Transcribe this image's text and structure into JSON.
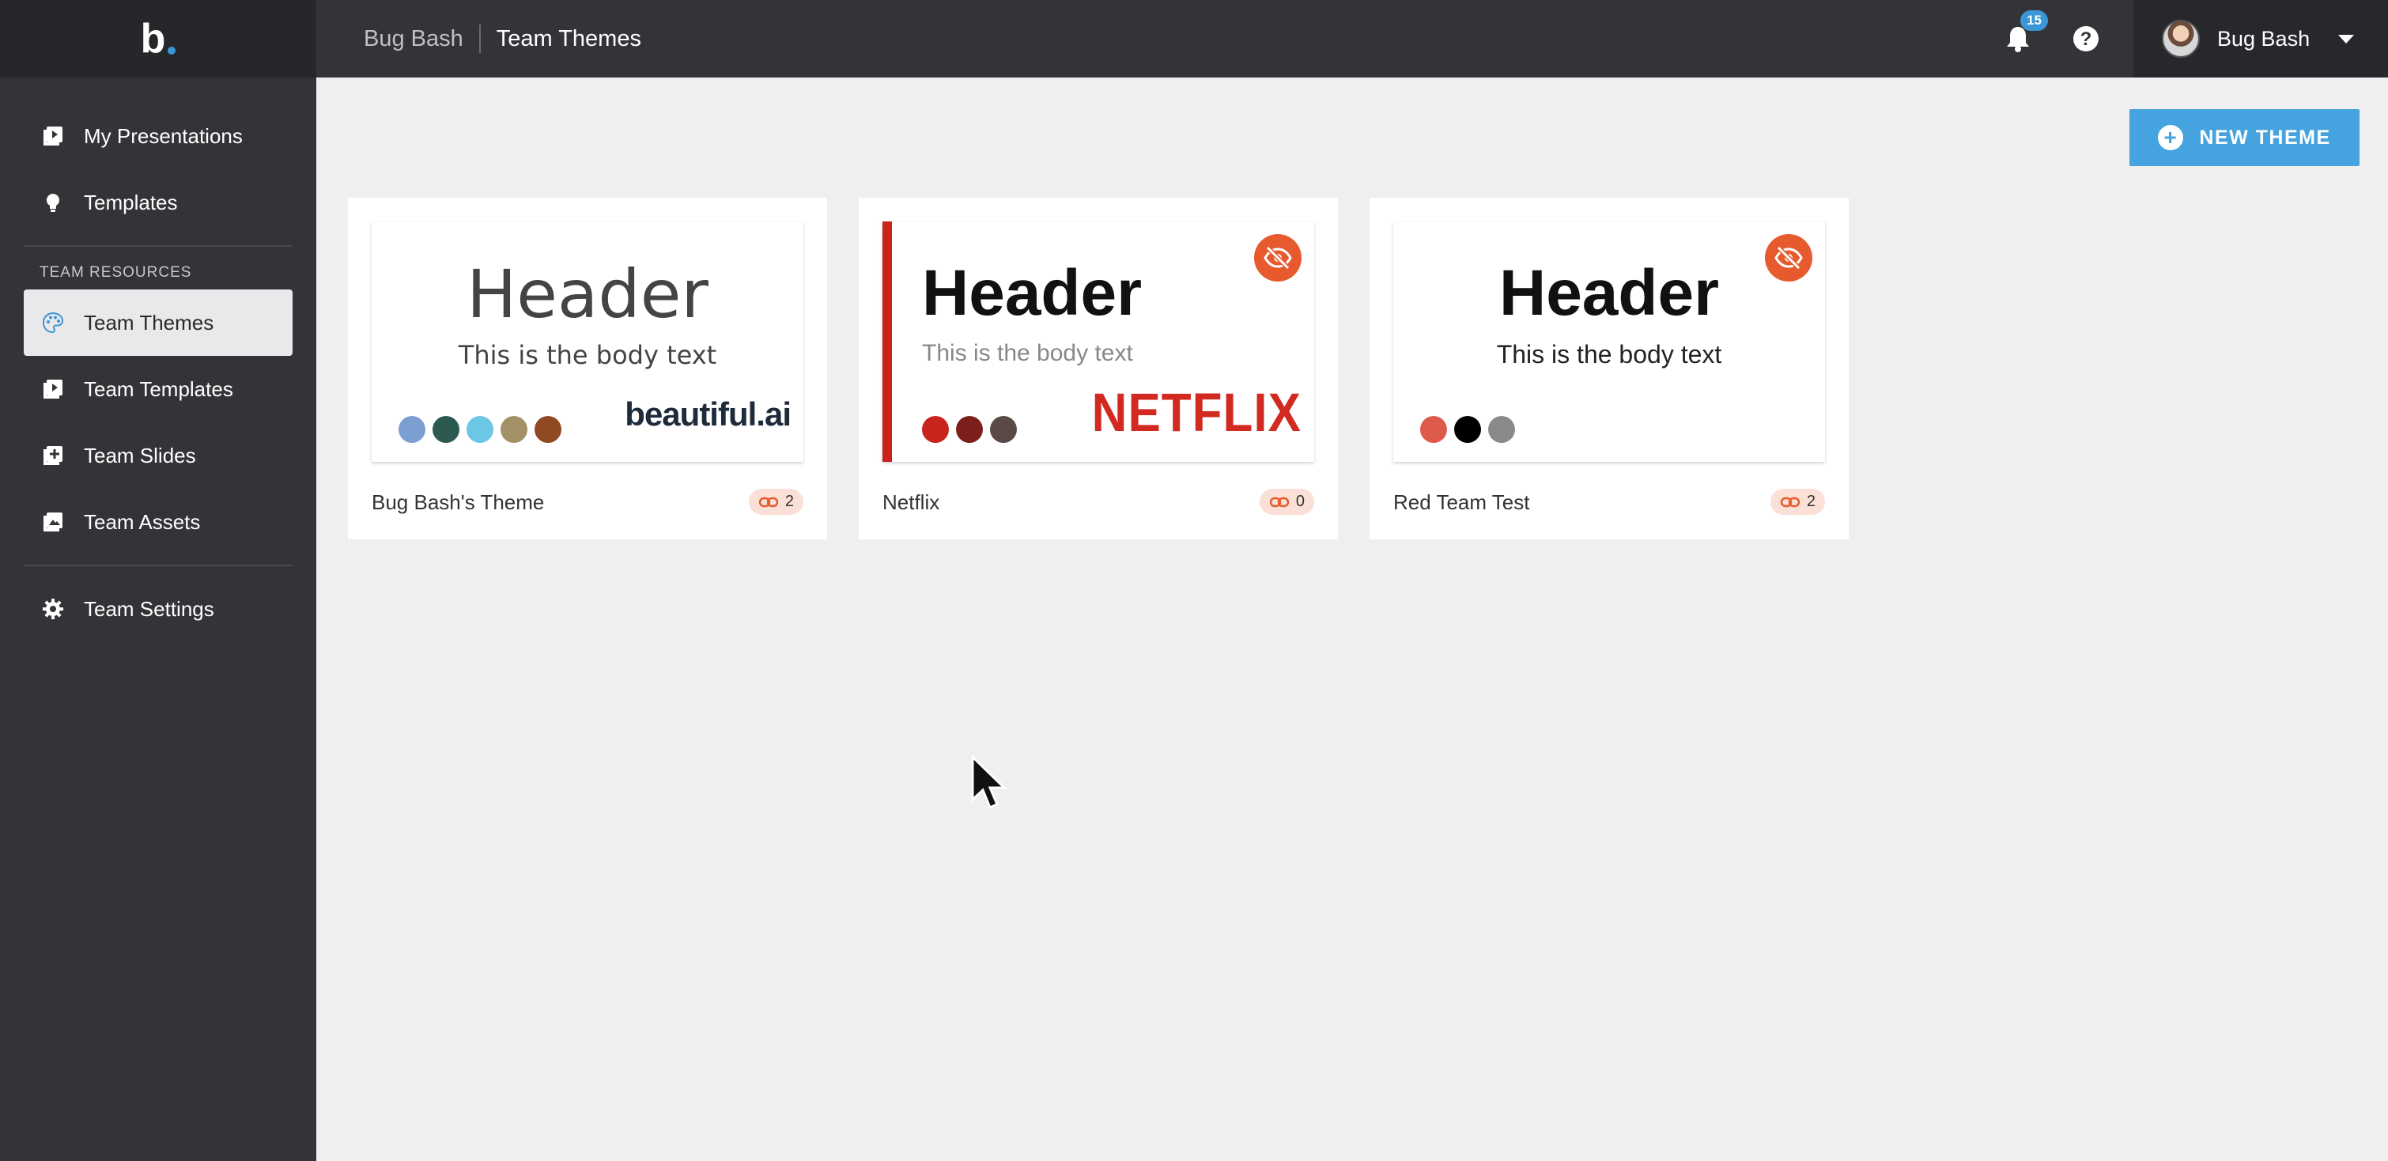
{
  "app": {
    "logo": "b."
  },
  "sidebar": {
    "items": [
      {
        "label": "My Presentations",
        "icon": "presentation-icon"
      },
      {
        "label": "Templates",
        "icon": "lightbulb-icon"
      }
    ],
    "section_label": "TEAM RESOURCES",
    "team_items": [
      {
        "label": "Team Themes",
        "icon": "palette-icon",
        "active": true
      },
      {
        "label": "Team Templates",
        "icon": "presentation-icon"
      },
      {
        "label": "Team Slides",
        "icon": "add-slide-icon"
      },
      {
        "label": "Team Assets",
        "icon": "image-icon"
      }
    ],
    "settings": {
      "label": "Team Settings",
      "icon": "gear-icon"
    }
  },
  "header": {
    "breadcrumb_root": "Bug Bash",
    "breadcrumb_current": "Team Themes",
    "notifications_count": "15",
    "user_name": "Bug Bash"
  },
  "actions": {
    "new_theme_label": "NEW THEME"
  },
  "themes": [
    {
      "name": "Bug Bash's Theme",
      "usage": "2",
      "preview_header": "Header",
      "preview_body": "This is the body text",
      "logo": "beautiful.ai",
      "swatches": [
        "#7b9fd1",
        "#2d5a50",
        "#6cc6e6",
        "#a39067",
        "#8f4a22"
      ]
    },
    {
      "name": "Netflix",
      "usage": "0",
      "preview_header": "Header",
      "preview_body": "This is the body text",
      "logo": "NETFLIX",
      "swatches": [
        "#c8241b",
        "#7c1f1a",
        "#5a4a47"
      ]
    },
    {
      "name": "Red Team Test",
      "usage": "2",
      "preview_header": "Header",
      "preview_body": "This is the body text",
      "swatches": [
        "#de5a4b",
        "#000000",
        "#8a8a8a"
      ]
    }
  ],
  "colors": {
    "accent": "#45a3df",
    "sidebar": "#333437",
    "hidden": "#e75a2d",
    "logo_dot": "#3a96d6"
  }
}
